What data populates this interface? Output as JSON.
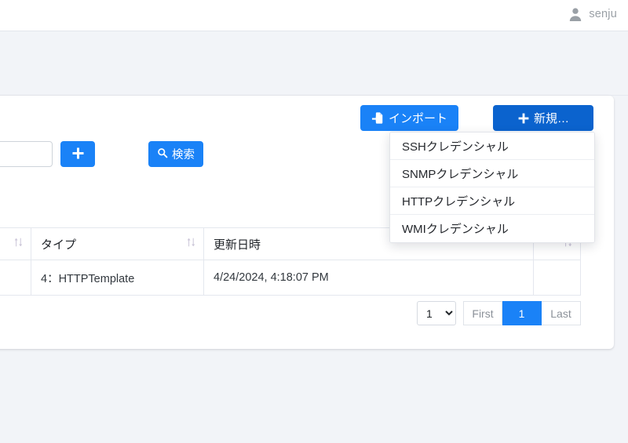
{
  "topbar": {
    "user_name": "senju",
    "avatar_icon": "user-icon"
  },
  "breadcrumb": {
    "text": "."
  },
  "toolbar": {
    "import_label": "インポート",
    "import_icon": "file-import-icon",
    "new_label": "新規…",
    "new_icon": "plus-icon",
    "export_icon": "file-export-icon",
    "accent_light": "#1a82f7",
    "accent_dark": "#0b63ce"
  },
  "search": {
    "input_value": "",
    "input_placeholder": "",
    "add_icon": "plus-icon",
    "search_label": "検索",
    "search_icon": "magnifier-icon"
  },
  "dropdown": {
    "items": [
      {
        "label": "SSHクレデンシャル"
      },
      {
        "label": "SNMPクレデンシャル"
      },
      {
        "label": "HTTPクレデンシャル"
      },
      {
        "label": "WMIクレデンシャル"
      }
    ]
  },
  "table": {
    "columns": [
      {
        "label": "",
        "sortable": true
      },
      {
        "label": "タイプ",
        "sortable": true
      },
      {
        "label": "更新日時",
        "sortable": true
      },
      {
        "label": "",
        "sortable": false
      }
    ],
    "rows": [
      {
        "c0": "",
        "c1": "4：HTTPTemplate",
        "c2": "4/24/2024, 4:18:07 PM",
        "c3": ""
      }
    ],
    "sort_icon": "sort-updown-icon"
  },
  "pagination": {
    "page_size_value": "1",
    "page_size_options": [
      "1"
    ],
    "first_label": "First",
    "current_page": "1",
    "last_label": "Last",
    "chevron_icon": "chevron-down-icon"
  }
}
